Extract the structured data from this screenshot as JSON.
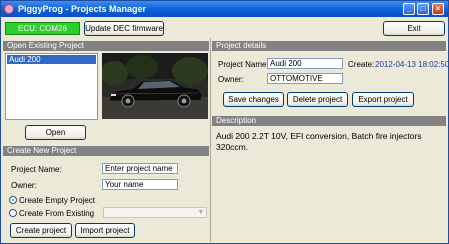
{
  "window": {
    "title": "PiggyProg - Projects Manager"
  },
  "toolbar": {
    "ecu_status": "ECU: COM26",
    "update_firmware_label": "Update DEC firmware",
    "exit_label": "Exit"
  },
  "open_existing": {
    "header": "Open Existing Project",
    "projects": [
      "Audi 200"
    ],
    "selected_project": "Audi 200",
    "open_label": "Open"
  },
  "create_new": {
    "header": "Create New Project",
    "project_name_label": "Project Name:",
    "project_name_value": "Enter project name",
    "owner_label": "Owner:",
    "owner_value": "Your name",
    "create_empty_label": "Create Empty Project",
    "create_from_existing_label": "Create From Existing",
    "selected_option": "Create Empty Project",
    "create_project_label": "Create project",
    "import_project_label": "Import project"
  },
  "project_details": {
    "header": "Project details",
    "project_name_label": "Project Name:",
    "project_name_value": "Audi 200",
    "create_label": "Create:",
    "create_date": "2012-04-13 18:02:50",
    "owner_label": "Owner:",
    "owner_value": "OTTOMOTIVE",
    "save_label": "Save changes",
    "delete_label": "Delete project",
    "export_label": "Export project"
  },
  "description": {
    "header": "Description",
    "text": "Audi 200 2.2T 10V, EFI conversion, Batch fire injectors 320ccm."
  },
  "colors": {
    "ecu_ok": "#28d028",
    "section_header": "#828282",
    "selection": "#316ac5",
    "date_text": "#1a3ea8"
  }
}
